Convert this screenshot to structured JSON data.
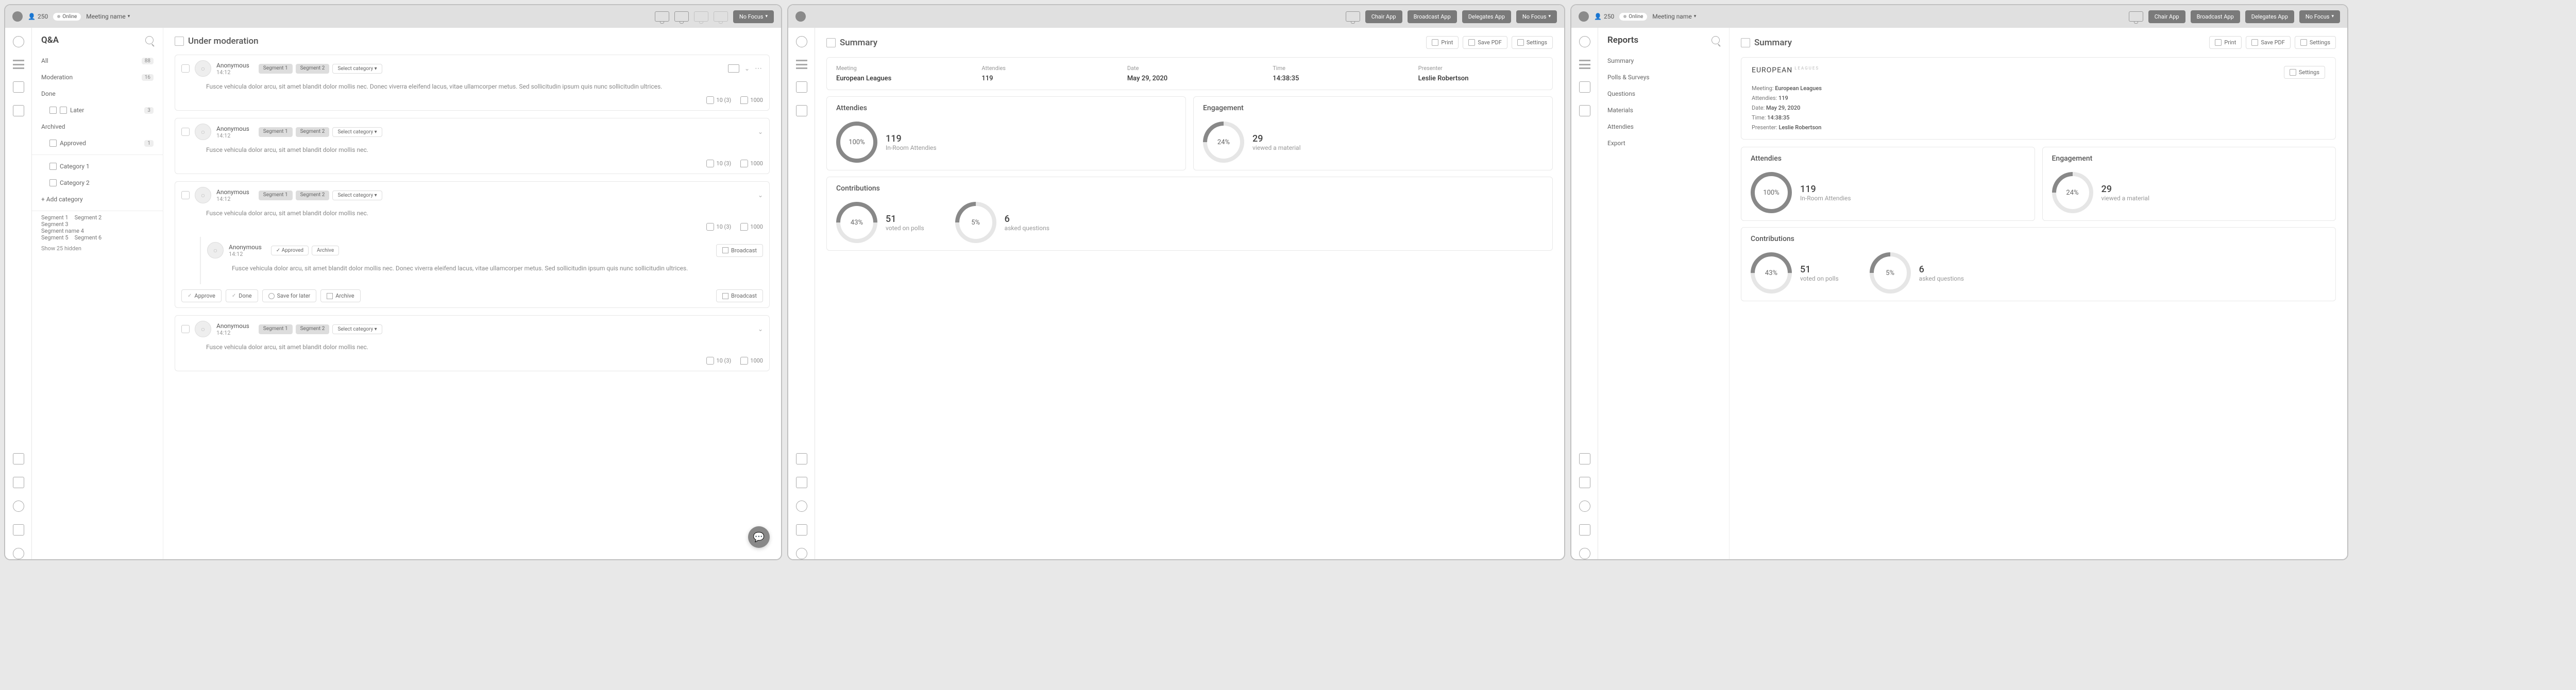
{
  "topbar": {
    "user_count": "250",
    "online_label": "Online",
    "meeting_name": "Meeting name",
    "chair_btn": "Chair App",
    "broadcast_btn": "Broadcast App",
    "delegates_btn": "Delegates App",
    "nofocus_btn": "No Focus"
  },
  "qa": {
    "title": "Q&A",
    "main_title": "Under moderation",
    "filters": {
      "all": {
        "label": "All",
        "badge": "88"
      },
      "moderation": {
        "label": "Moderation",
        "badge": "16"
      },
      "done": {
        "label": "Done"
      },
      "later": {
        "label": "Later",
        "badge": "3"
      },
      "archived": {
        "label": "Archived"
      },
      "approved": {
        "label": "Approved",
        "badge": "1"
      }
    },
    "cats": {
      "c1": "Category 1",
      "c2": "Category 2",
      "add": "+ Add category"
    },
    "segs": {
      "s1": "Segment 1",
      "s2": "Segment 2",
      "s3": "Segment 3",
      "s4": "Segment name 4",
      "s5": "Segment 5",
      "s6": "Segment 6"
    },
    "show_hidden": "Show 25 hidden",
    "anon": "Anonymous",
    "time": "14:12",
    "tag1": "Segment 1",
    "tag2": "Segment 2",
    "select_cat": "Select category",
    "approved_tag": "Approved",
    "archive_tag": "Archive",
    "long_text": "Fusce vehicula dolor arcu, sit amet blandit dolor mollis nec. Donec viverra eleifend lacus, vitae ullamcorper metus. Sed sollicitudin ipsum quis nunc sollicitudin ultrices.",
    "short_text": "Fusce vehicula dolor arcu, sit amet blandit dolor mollis nec.",
    "comments": "10 (3)",
    "likes": "1000",
    "approve_btn": "Approve",
    "done_btn": "Done",
    "later_btn": "Save for later",
    "archive_btn": "Archive",
    "broadcast_btn": "Broadcast"
  },
  "summary": {
    "title": "Summary",
    "print_btn": "Print",
    "save_btn": "Save PDF",
    "settings_btn": "Settings",
    "info": {
      "meeting_lbl": "Meeting",
      "meeting_val": "European Leagues",
      "attendees_lbl": "Attendies",
      "attendees_val": "119",
      "date_lbl": "Date",
      "date_val": "May 29, 2020",
      "time_lbl": "Time",
      "time_val": "14:38:35",
      "presenter_lbl": "Presenter",
      "presenter_val": "Leslie Robertson"
    },
    "attendees_card": "Attendies",
    "engagement_card": "Engagement",
    "contributions_card": "Contributions",
    "m1": {
      "pct": "100%",
      "big": "119",
      "sm": "In-Room Attendies"
    },
    "m2": {
      "pct": "24%",
      "big": "29",
      "sm": "viewed a material"
    },
    "m3": {
      "pct": "43%",
      "big": "51",
      "sm": "voted on polls"
    },
    "m4": {
      "pct": "5%",
      "big": "6",
      "sm": "asked questions"
    }
  },
  "reports": {
    "title": "Reports",
    "items": {
      "summary": "Summary",
      "polls": "Polls & Surveys",
      "questions": "Questions",
      "materials": "Materials",
      "attendees": "Attendies",
      "export": "Export"
    },
    "doc_title": "EUROPEAN",
    "doc_sup": "LEAGUES",
    "l1a": "Meeting:",
    "l1b": "European Leagues",
    "l2a": "Attendies:",
    "l2b": "119",
    "l3a": "Date:",
    "l3b": "May 29, 2020",
    "l4a": "Time:",
    "l4b": "14:38:35",
    "l5a": "Presenter:",
    "l5b": "Leslie Robertson"
  }
}
